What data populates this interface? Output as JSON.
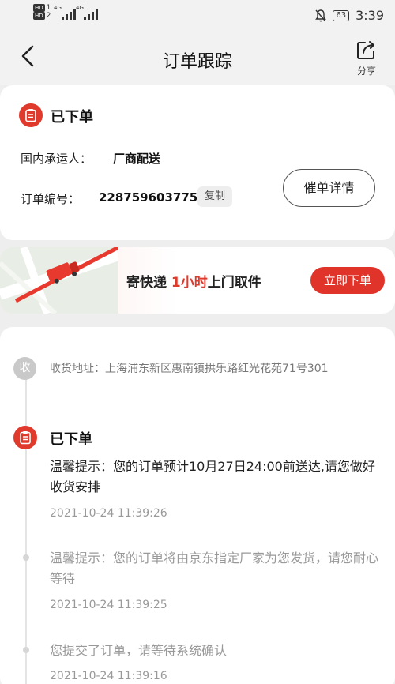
{
  "statusbar": {
    "hd1": "HD",
    "sub1": "1",
    "hd2": "HD",
    "sub2": "2",
    "net1": "4G",
    "net2": "4G",
    "battery": "63",
    "time": "3:39"
  },
  "header": {
    "title": "订单跟踪",
    "share_label": "分享"
  },
  "order": {
    "status": "已下单",
    "carrier_label": "国内承运人：",
    "carrier_value": "厂商配送",
    "number_label": "订单编号：",
    "number_value": "228759603775",
    "copy_label": "复制",
    "urge_label": "催单详情"
  },
  "banner": {
    "text_prefix": "寄快递 ",
    "text_highlight": "1小时",
    "text_suffix": "上门取件",
    "button_label": "立即下单"
  },
  "tracking": {
    "address_icon": "收",
    "address": "收货地址：上海浦东新区惠南镇拱乐路红光花苑71号301",
    "status": "已下单",
    "events": [
      {
        "text": "温馨提示：您的订单预计10月27日24:00前送达,请您做好收货安排",
        "time": "2021-10-24 11:39:26",
        "color": "#222222"
      },
      {
        "text": "温馨提示：您的订单将由京东指定厂家为您发货，请您耐心等待",
        "time": "2021-10-24 11:39:25",
        "color": "#999999"
      },
      {
        "text": "您提交了订单，请等待系统确认",
        "time": "2021-10-24 11:39:16",
        "color": "#999999"
      }
    ]
  },
  "icons": {
    "back": "chevron-left-icon",
    "share": "share-icon",
    "order_status": "clipboard-icon",
    "truck": "truck-icon",
    "mute": "bell-off-icon"
  },
  "colors": {
    "accent": "#e03a2c",
    "background": "#eeeeee"
  }
}
